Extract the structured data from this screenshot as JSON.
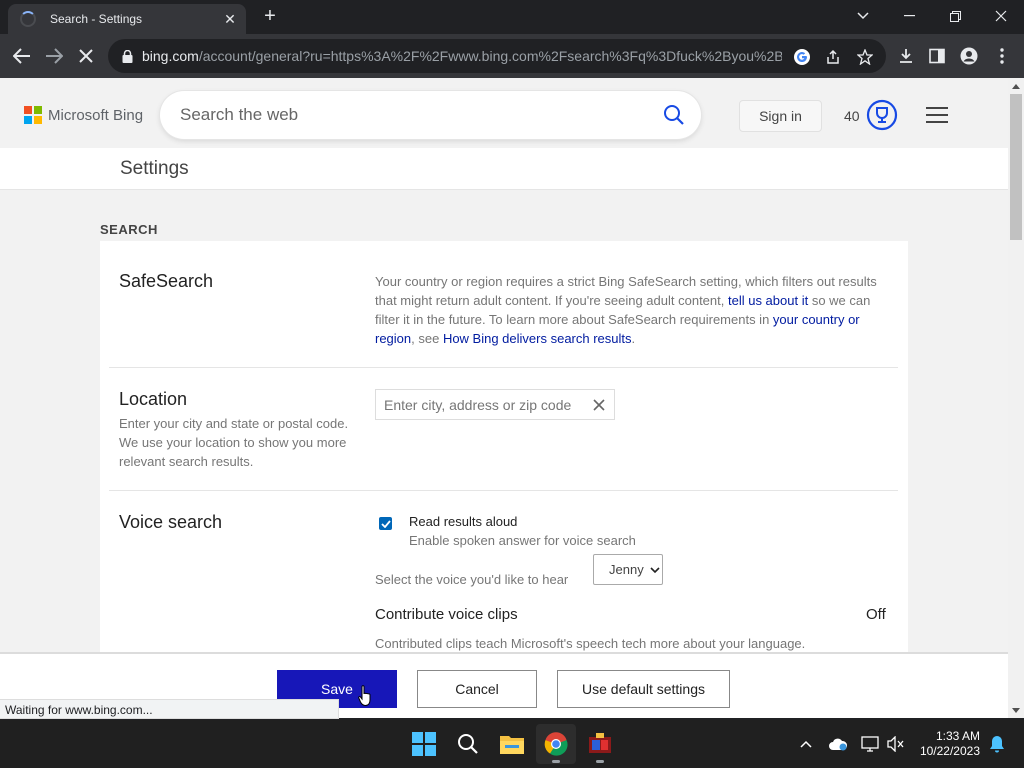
{
  "browser": {
    "tab_title": "Search - Settings",
    "url_host": "bing.com",
    "url_path": "/account/general?ru=https%3A%2F%2Fwww.bing.com%2Fsearch%3Fq%3Dfuck%2Byou%2Bt...",
    "status_text": "Waiting for www.bing.com..."
  },
  "header": {
    "logo_text": "Microsoft Bing",
    "search_placeholder": "Search the web",
    "signin_label": "Sign in",
    "rewards_points": "40"
  },
  "settings": {
    "title": "Settings",
    "section": "SEARCH",
    "safesearch": {
      "label": "SafeSearch",
      "text1": "Your country or region requires a strict Bing SafeSearch setting, which filters out results that might return adult content. If you're seeing adult content, ",
      "link1": "tell us about it",
      "text2": " so we can filter it in the future. To learn more about SafeSearch requirements in ",
      "link2": "your country or region",
      "text3": ", see ",
      "link3": "How Bing delivers search results",
      "text4": "."
    },
    "location": {
      "label": "Location",
      "desc": "Enter your city and state or postal code. We use your location to show you more relevant search results.",
      "placeholder": "Enter city, address or zip code"
    },
    "voice": {
      "label": "Voice search",
      "read_aloud_label": "Read results aloud",
      "read_aloud_desc": "Enable spoken answer for voice search",
      "read_aloud_checked": true,
      "voice_select_label": "Select the voice you'd like to hear",
      "voice_selected": "Jenny",
      "contribute_label": "Contribute voice clips",
      "contribute_value": "Off",
      "contribute_desc": "Contributed clips teach Microsoft's speech tech more about your language."
    }
  },
  "buttons": {
    "save": "Save",
    "cancel": "Cancel",
    "default": "Use default settings"
  },
  "taskbar": {
    "time": "1:33 AM",
    "date": "10/22/2023"
  },
  "colors": {
    "save_button": "#1717b8",
    "link": "#001ba0",
    "checkbox": "#0067b8"
  }
}
